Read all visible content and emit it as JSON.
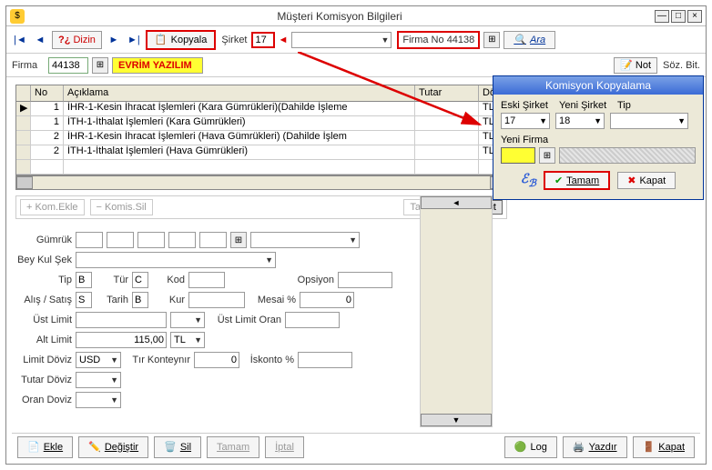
{
  "window": {
    "title": "Müşteri Komisyon Bilgileri"
  },
  "toolbar": {
    "dizin_label": "Dizin",
    "kopyala_label": "Kopyala",
    "sirket_label": "Şirket",
    "sirket_value": "17",
    "sirket_combo2": "",
    "firmano_label": "Firma No",
    "firmano_value": "44138",
    "ara_label": "Ara"
  },
  "row2": {
    "firma_label": "Firma",
    "firma_no": "44138",
    "firma_name": "EVRİM YAZILIM",
    "not_label": "Not",
    "sozbit_label": "Söz. Bit."
  },
  "grid": {
    "headers": {
      "no": "No",
      "aciklama": "Açıklama",
      "tutar": "Tutar",
      "doviz": "Döviz"
    },
    "rows": [
      {
        "no": "1",
        "aciklama": "İHR-1-Kesin İhracat İşlemleri (Kara Gümrükleri)(Dahilde İşleme",
        "tutar": "",
        "doviz": "TL"
      },
      {
        "no": "1",
        "aciklama": "İTH-1-İthalat İşlemleri  (Kara Gümrükleri)",
        "tutar": "",
        "doviz": "TL"
      },
      {
        "no": "2",
        "aciklama": "İHR-1-Kesin İhracat İşlemleri (Hava Gümrükleri) (Dahilde İşlem",
        "tutar": "",
        "doviz": "TL"
      },
      {
        "no": "2",
        "aciklama": "İTH-1-İthalat İşlemleri  (Hava Gümrükleri)",
        "tutar": "",
        "doviz": "TL"
      }
    ]
  },
  "midbar": {
    "kom_ekle": "Kom.Ekle",
    "komis_sil": "Komis.Sil",
    "tarife_ekle": "Tarife Ekle",
    "limit": "Limit"
  },
  "form": {
    "gumruk": "Gümrük",
    "bey_kul_sek": "Bey Kul Şek",
    "tip": "Tip",
    "tip_v": "B",
    "tur": "Tür",
    "tur_v": "C",
    "kod": "Kod",
    "opsiyon": "Opsiyon",
    "alis_satis": "Alış / Satış",
    "alis_satis_v": "S",
    "tarih": "Tarih",
    "tarih_v": "B",
    "kur": "Kur",
    "mesai": "Mesai %",
    "mesai_v": "0",
    "ust_limit": "Üst Limit",
    "ust_limit_oran": "Üst Limit Oran",
    "alt_limit": "Alt Limit",
    "alt_limit_v": "115,00",
    "alt_limit_dov": "TL",
    "limit_doviz": "Limit Döviz",
    "limit_doviz_v": "USD",
    "tir_konteynir": "Tır Konteynır",
    "tir_konteynir_v": "0",
    "iskonto": "İskonto %",
    "tutar_doviz": "Tutar Döviz",
    "oran_doviz": "Oran Doviz"
  },
  "popup": {
    "title": "Komisyon Kopyalama",
    "eski_sirket": "Eski Şirket",
    "eski_sirket_v": "17",
    "yeni_sirket": "Yeni Şirket",
    "yeni_sirket_v": "18",
    "tip": "Tip",
    "yeni_firma": "Yeni Firma",
    "tamam": "Tamam",
    "kapat": "Kapat"
  },
  "bottom": {
    "ekle": "Ekle",
    "degistir": "Değiştir",
    "sil": "Sil",
    "tamam": "Tamam",
    "iptal": "İptal",
    "log": "Log",
    "yazdir": "Yazdır",
    "kapat": "Kapat"
  }
}
